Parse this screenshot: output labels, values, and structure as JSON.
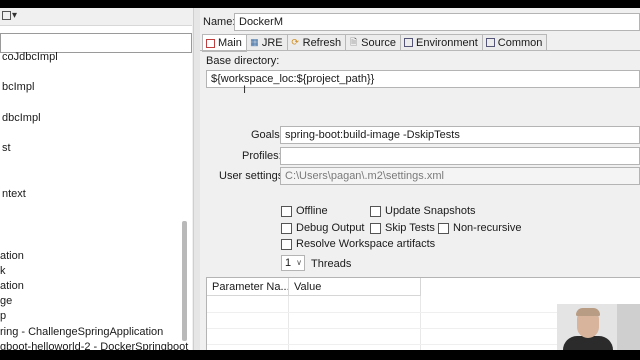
{
  "left_panel": {
    "items": [
      {
        "label": "coJdbcImpl"
      },
      {
        "label": "bcImpl"
      },
      {
        "label": "dbcImpl"
      },
      {
        "label": "st"
      },
      {
        "label": "ntext"
      },
      {
        "label": "ation"
      },
      {
        "label": "k"
      },
      {
        "label": "ation"
      },
      {
        "label": "ge"
      },
      {
        "label": "p"
      },
      {
        "label": "ring - ChallengeSpringApplication"
      },
      {
        "label": "gboot-helloworld-2 - DockerSpringboot"
      }
    ]
  },
  "config": {
    "name_label": "Name:",
    "name_value": "DockerM",
    "tabs": [
      {
        "label": "Main",
        "icon": "main-tab-icon"
      },
      {
        "label": "JRE",
        "icon": "jre-tab-icon"
      },
      {
        "label": "Refresh",
        "icon": "refresh-tab-icon"
      },
      {
        "label": "Source",
        "icon": "source-tab-icon"
      },
      {
        "label": "Environment",
        "icon": "environment-tab-icon"
      },
      {
        "label": "Common",
        "icon": "common-tab-icon"
      }
    ],
    "base_directory_label": "Base directory:",
    "base_directory_value": "${workspace_loc:${project_path}}",
    "goals_label": "Goals:",
    "goals_value": "spring-boot:build-image  -DskipTests",
    "profiles_label": "Profiles:",
    "profiles_value": "",
    "user_settings_label": "User settings:",
    "user_settings_value": "C:\\Users\\pagan\\.m2\\settings.xml",
    "checkboxes": {
      "offline": "Offline",
      "update_snapshots": "Update Snapshots",
      "debug_output": "Debug Output",
      "skip_tests": "Skip Tests",
      "non_recursive": "Non-recursive",
      "resolve_workspace": "Resolve Workspace artifacts"
    },
    "threads_value": "1",
    "threads_label": "Threads",
    "table_headers": [
      "Parameter Na...",
      "Value"
    ]
  },
  "colors": {
    "background": "#f0f0f0",
    "field": "#ffffff",
    "border": "#b4b4b4"
  }
}
